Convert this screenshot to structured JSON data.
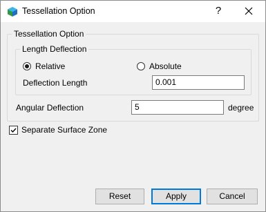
{
  "window": {
    "title": "Tessellation Option",
    "help_label": "?",
    "icons": {
      "app": "app-cube-icon",
      "close": "close-icon"
    }
  },
  "tessellation_group": {
    "legend": "Tessellation Option",
    "length_deflection": {
      "legend": "Length Deflection",
      "relative_label": "Relative",
      "absolute_label": "Absolute",
      "selected": "Relative",
      "deflection_length_label": "Deflection Length",
      "deflection_length_value": "0.001"
    },
    "angular_deflection_label": "Angular Deflection",
    "angular_deflection_value": "5",
    "angular_unit": "degree"
  },
  "separate_surface_zone": {
    "label": "Separate Surface Zone",
    "checked": true
  },
  "buttons": {
    "reset": "Reset",
    "apply": "Apply",
    "cancel": "Cancel"
  },
  "colors": {
    "accent": "#0078d7",
    "background": "#f0f0f0",
    "titlebar": "#ffffff"
  }
}
